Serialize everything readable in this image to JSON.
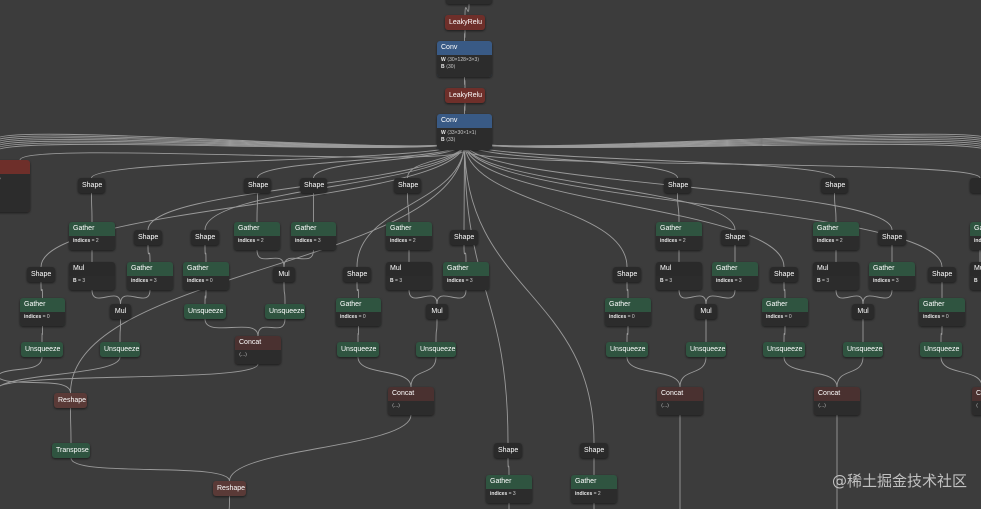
{
  "colors": {
    "background": "#3c3c3c",
    "edge": "#9a9a9a",
    "layer": "#395a85",
    "activation": "#6e2f2a",
    "shape": "#2a2a2a",
    "gather": "#2f5440",
    "math": "#2a2a2a",
    "concat": "#4a3130",
    "reshape": "#5a3a37",
    "body": "#2c2c2c"
  },
  "watermark": "@稀土掘金技术社区",
  "nodes": [
    {
      "id": "top",
      "label": "",
      "type": "math",
      "kind": "cut",
      "attrs": [
        {
          "k": "B",
          "v": "⟨...⟩"
        }
      ]
    },
    {
      "id": "lr1",
      "label": "LeakyRelu",
      "type": "activation",
      "kind": "simple"
    },
    {
      "id": "conv1",
      "label": "Conv",
      "type": "layer",
      "kind": "boxed",
      "attrs": [
        {
          "k": "W",
          "v": "⟨30×128×3×3⟩"
        },
        {
          "k": "B",
          "v": "⟨30⟩"
        }
      ]
    },
    {
      "id": "lr2",
      "label": "LeakyRelu",
      "type": "activation",
      "kind": "simple"
    },
    {
      "id": "conv2",
      "label": "Conv",
      "type": "layer",
      "kind": "boxed",
      "attrs": [
        {
          "k": "W",
          "v": "⟨33×30×1×1⟩"
        },
        {
          "k": "B",
          "v": "⟨33⟩"
        }
      ]
    },
    {
      "id": "leftcut",
      "label": "e",
      "type": "activation",
      "kind": "cut",
      "attrs": [
        {
          "k": "e",
          "v": "⟨1⟩"
        },
        {
          "k": "",
          "v": "⟨1⟩"
        },
        {
          "k": "",
          "v": "⟨1⟩"
        },
        {
          "k": "",
          "v": "⟨1⟩"
        }
      ]
    },
    {
      "id": "rightcut",
      "label": "",
      "type": "math",
      "kind": "simple"
    },
    {
      "id": "sh_a1",
      "label": "Shape",
      "type": "shape",
      "kind": "simple"
    },
    {
      "id": "ga_a1",
      "label": "Gather",
      "type": "gather",
      "kind": "boxed",
      "attrs": [
        {
          "k": "indices",
          "v": "= 2"
        }
      ]
    },
    {
      "id": "mu_a1",
      "label": "Mul",
      "type": "math",
      "kind": "boxed",
      "attrs": [
        {
          "k": "B",
          "v": "= 3"
        }
      ]
    },
    {
      "id": "sh_a2",
      "label": "Shape",
      "type": "shape",
      "kind": "simple"
    },
    {
      "id": "ga_a2",
      "label": "Gather",
      "type": "gather",
      "kind": "boxed",
      "attrs": [
        {
          "k": "indices",
          "v": "= 3"
        }
      ]
    },
    {
      "id": "mu_a2",
      "label": "Mul",
      "type": "math",
      "kind": "simple"
    },
    {
      "id": "sh_a3",
      "label": "Shape",
      "type": "shape",
      "kind": "simple"
    },
    {
      "id": "ga_a3",
      "label": "Gather",
      "type": "gather",
      "kind": "boxed",
      "attrs": [
        {
          "k": "indices",
          "v": "= 0"
        }
      ]
    },
    {
      "id": "un_a1",
      "label": "Unsqueeze",
      "type": "gather",
      "kind": "simple"
    },
    {
      "id": "un_a2",
      "label": "Unsqueeze",
      "type": "gather",
      "kind": "simple"
    },
    {
      "id": "rs_a",
      "label": "Reshape",
      "type": "reshape",
      "kind": "simple"
    },
    {
      "id": "tp_a",
      "label": "Transpose",
      "type": "gather",
      "kind": "simple"
    },
    {
      "id": "rs_b",
      "label": "Reshape",
      "type": "reshape",
      "kind": "simple"
    },
    {
      "id": "sh_b0",
      "label": "Shape",
      "type": "shape",
      "kind": "simple"
    },
    {
      "id": "ga_b0",
      "label": "Gather",
      "type": "gather",
      "kind": "boxed",
      "attrs": [
        {
          "k": "indices",
          "v": "= 0"
        }
      ]
    },
    {
      "id": "un_b0",
      "label": "Unsqueeze",
      "type": "gather",
      "kind": "simple"
    },
    {
      "id": "sh_b1",
      "label": "Shape",
      "type": "shape",
      "kind": "simple"
    },
    {
      "id": "ga_b1",
      "label": "Gather",
      "type": "gather",
      "kind": "boxed",
      "attrs": [
        {
          "k": "indices",
          "v": "= 2"
        }
      ]
    },
    {
      "id": "sh_b2",
      "label": "Shape",
      "type": "shape",
      "kind": "simple"
    },
    {
      "id": "ga_b2",
      "label": "Gather",
      "type": "gather",
      "kind": "boxed",
      "attrs": [
        {
          "k": "indices",
          "v": "= 3"
        }
      ]
    },
    {
      "id": "mu_b",
      "label": "Mul",
      "type": "math",
      "kind": "simple"
    },
    {
      "id": "un_b1",
      "label": "Unsqueeze",
      "type": "gather",
      "kind": "simple"
    },
    {
      "id": "cc_b",
      "label": "Concat",
      "type": "concat",
      "kind": "boxed",
      "attrs": [
        {
          "k": "",
          "v": "⟨...⟩"
        }
      ]
    },
    {
      "id": "sh_c0",
      "label": "Shape",
      "type": "shape",
      "kind": "simple"
    },
    {
      "id": "ga_c0",
      "label": "Gather",
      "type": "gather",
      "kind": "boxed",
      "attrs": [
        {
          "k": "indices",
          "v": "= 0"
        }
      ]
    },
    {
      "id": "un_c0",
      "label": "Unsqueeze",
      "type": "gather",
      "kind": "simple"
    },
    {
      "id": "sh_c1",
      "label": "Shape",
      "type": "shape",
      "kind": "simple"
    },
    {
      "id": "ga_c1",
      "label": "Gather",
      "type": "gather",
      "kind": "boxed",
      "attrs": [
        {
          "k": "indices",
          "v": "= 2"
        }
      ]
    },
    {
      "id": "mu_c1",
      "label": "Mul",
      "type": "math",
      "kind": "boxed",
      "attrs": [
        {
          "k": "B",
          "v": "= 3"
        }
      ]
    },
    {
      "id": "sh_c2",
      "label": "Shape",
      "type": "shape",
      "kind": "simple"
    },
    {
      "id": "ga_c2",
      "label": "Gather",
      "type": "gather",
      "kind": "boxed",
      "attrs": [
        {
          "k": "indices",
          "v": "= 3"
        }
      ]
    },
    {
      "id": "mu_c2",
      "label": "Mul",
      "type": "math",
      "kind": "simple"
    },
    {
      "id": "un_c1",
      "label": "Unsqueeze",
      "type": "gather",
      "kind": "simple"
    },
    {
      "id": "cc_c",
      "label": "Concat",
      "type": "concat",
      "kind": "boxed",
      "attrs": [
        {
          "k": "",
          "v": "⟨...⟩"
        }
      ]
    },
    {
      "id": "sh_d1",
      "label": "Shape",
      "type": "shape",
      "kind": "simple"
    },
    {
      "id": "ga_d1",
      "label": "Gather",
      "type": "gather",
      "kind": "boxed",
      "attrs": [
        {
          "k": "indices",
          "v": "= 3"
        }
      ]
    },
    {
      "id": "sh_d2",
      "label": "Shape",
      "type": "shape",
      "kind": "simple"
    },
    {
      "id": "ga_d2",
      "label": "Gather",
      "type": "gather",
      "kind": "boxed",
      "attrs": [
        {
          "k": "indices",
          "v": "= 2"
        }
      ]
    },
    {
      "id": "sh_e0",
      "label": "Shape",
      "type": "shape",
      "kind": "simple"
    },
    {
      "id": "ga_e0",
      "label": "Gather",
      "type": "gather",
      "kind": "boxed",
      "attrs": [
        {
          "k": "indices",
          "v": "= 0"
        }
      ]
    },
    {
      "id": "un_e0",
      "label": "Unsqueeze",
      "type": "gather",
      "kind": "simple"
    },
    {
      "id": "sh_e1",
      "label": "Shape",
      "type": "shape",
      "kind": "simple"
    },
    {
      "id": "ga_e1",
      "label": "Gather",
      "type": "gather",
      "kind": "boxed",
      "attrs": [
        {
          "k": "indices",
          "v": "= 2"
        }
      ]
    },
    {
      "id": "mu_e1",
      "label": "Mul",
      "type": "math",
      "kind": "boxed",
      "attrs": [
        {
          "k": "B",
          "v": "= 3"
        }
      ]
    },
    {
      "id": "sh_e2",
      "label": "Shape",
      "type": "shape",
      "kind": "simple"
    },
    {
      "id": "ga_e2",
      "label": "Gather",
      "type": "gather",
      "kind": "boxed",
      "attrs": [
        {
          "k": "indices",
          "v": "= 3"
        }
      ]
    },
    {
      "id": "mu_e2",
      "label": "Mul",
      "type": "math",
      "kind": "simple"
    },
    {
      "id": "un_e1",
      "label": "Unsqueeze",
      "type": "gather",
      "kind": "simple"
    },
    {
      "id": "cc_e",
      "label": "Concat",
      "type": "concat",
      "kind": "boxed",
      "attrs": [
        {
          "k": "",
          "v": "⟨...⟩"
        }
      ]
    },
    {
      "id": "sh_f0",
      "label": "Shape",
      "type": "shape",
      "kind": "simple"
    },
    {
      "id": "ga_f0",
      "label": "Gather",
      "type": "gather",
      "kind": "boxed",
      "attrs": [
        {
          "k": "indices",
          "v": "= 0"
        }
      ]
    },
    {
      "id": "un_f0",
      "label": "Unsqueeze",
      "type": "gather",
      "kind": "simple"
    },
    {
      "id": "ga_f1",
      "label": "Ga",
      "type": "gather",
      "kind": "boxed",
      "attrs": [
        {
          "k": "ind",
          "v": ""
        }
      ]
    },
    {
      "id": "mu_f1",
      "label": "Mu",
      "type": "math",
      "kind": "boxed",
      "attrs": [
        {
          "k": "B",
          "v": ""
        }
      ]
    },
    {
      "id": "cc_f",
      "label": "Co",
      "type": "concat",
      "kind": "boxed",
      "attrs": [
        {
          "k": "",
          "v": "⟨"
        }
      ]
    }
  ]
}
